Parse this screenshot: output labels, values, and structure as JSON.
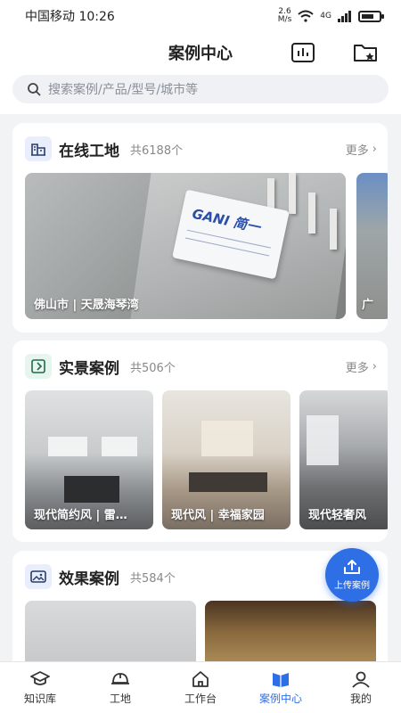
{
  "status": {
    "carrier": "中国移动",
    "time": "10:26",
    "net_speed": "2.6\nM/s",
    "network": "4G"
  },
  "header": {
    "title": "案例中心",
    "icons": [
      "chart-icon",
      "folder-star-icon"
    ]
  },
  "search": {
    "placeholder": "搜索案例/产品/型号/城市等"
  },
  "sections": {
    "online": {
      "title": "在线工地",
      "count": "共6188个",
      "more": "更多",
      "items": [
        "佛山市 | 天晟海琴湾",
        "广"
      ],
      "brand": "GANI 简一"
    },
    "real": {
      "title": "实景案例",
      "count": "共506个",
      "more": "更多",
      "items": [
        "现代简约风 | 雷…",
        "现代风 | 幸福家园",
        "现代轻奢风"
      ]
    },
    "render": {
      "title": "效果案例",
      "count": "共584个"
    }
  },
  "upload": {
    "label": "上传案例"
  },
  "tabs": [
    {
      "label": "知识库",
      "icon": "graduation-cap-icon"
    },
    {
      "label": "工地",
      "icon": "helmet-icon"
    },
    {
      "label": "工作台",
      "icon": "home-icon"
    },
    {
      "label": "案例中心",
      "icon": "case-book-icon",
      "active": true
    },
    {
      "label": "我的",
      "icon": "user-icon"
    }
  ],
  "colors": {
    "accent": "#2f6fe6",
    "background": "#f2f3f5"
  }
}
